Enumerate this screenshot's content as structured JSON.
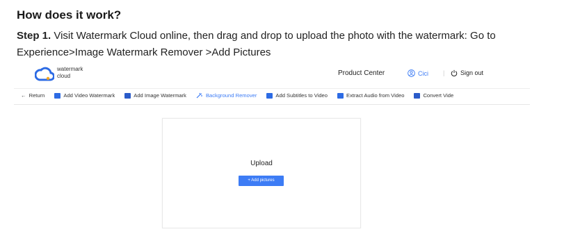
{
  "article": {
    "heading": "How does it work?",
    "step_label": "Step 1.",
    "step_text": " Visit Watermark Cloud online, then drag and drop to upload the photo with the watermark: Go to Experience>Image Watermark Remover >Add Pictures"
  },
  "app": {
    "logo_text": "watermark\ncloud",
    "header": {
      "product_center": "Product Center",
      "user_name": "Cici",
      "separator": "|",
      "sign_out": "Sign out"
    },
    "nav": {
      "return": "Return",
      "items": [
        {
          "label": "Add Video Watermark",
          "icon": "video-watermark-icon"
        },
        {
          "label": "Add Image Watermark",
          "icon": "image-watermark-icon"
        },
        {
          "label": "Background Remover",
          "icon": "background-remover-icon"
        },
        {
          "label": "Add Subtitles to Video",
          "icon": "subtitles-icon"
        },
        {
          "label": "Extract Audio from Video",
          "icon": "audio-icon"
        },
        {
          "label": "Convert Vide",
          "icon": "convert-icon"
        }
      ],
      "active_index": 2
    },
    "upload": {
      "title": "Upload",
      "button": "+ Add pictures"
    },
    "colors": {
      "accent": "#3d7cf5",
      "icon_blue": "#2d6be4"
    }
  }
}
